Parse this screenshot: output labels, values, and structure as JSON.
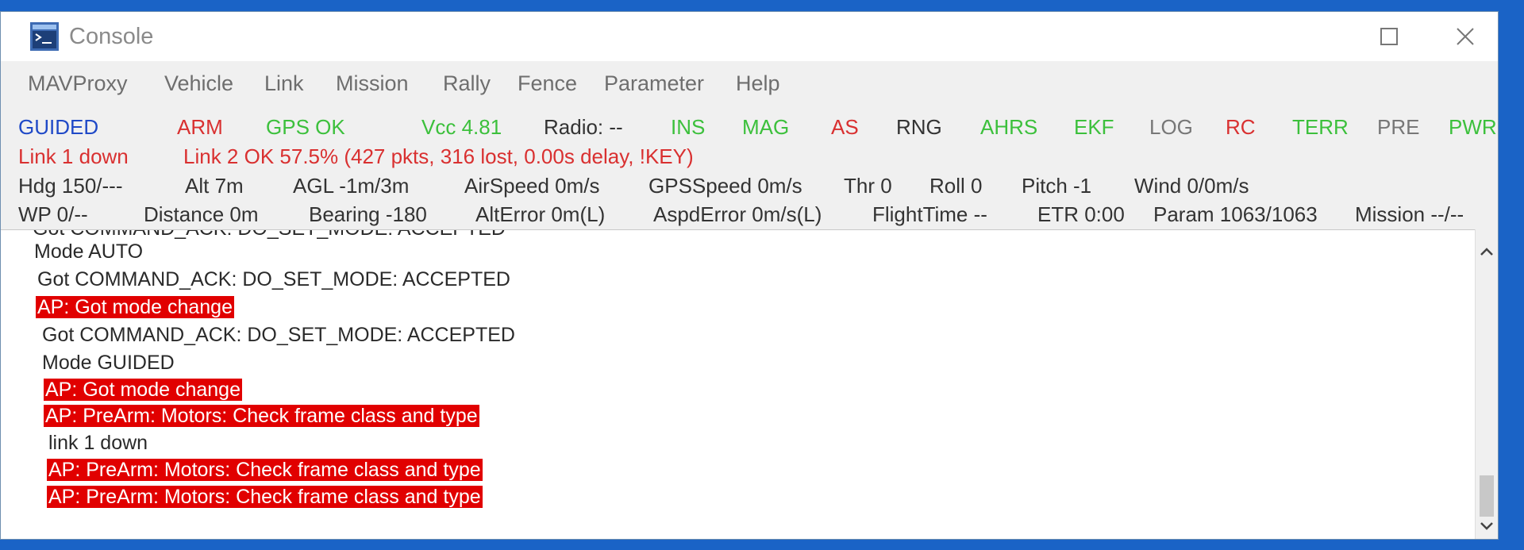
{
  "window": {
    "title": "Console",
    "icon": "terminal-app-icon"
  },
  "menu": [
    "MAVProxy",
    "Vehicle",
    "Link",
    "Mission",
    "Rally",
    "Fence",
    "Parameter",
    "Help"
  ],
  "status": {
    "row1": [
      {
        "text": "GUIDED",
        "color": "#1f49c7"
      },
      {
        "text": "ARM",
        "color": "#d93030"
      },
      {
        "text": "GPS OK",
        "color": "#3cc03c"
      },
      {
        "text": "Vcc 4.81",
        "color": "#3cc03c"
      },
      {
        "text": "Radio: --",
        "color": "#333333"
      },
      {
        "text": "INS",
        "color": "#3cc03c"
      },
      {
        "text": "MAG",
        "color": "#3cc03c"
      },
      {
        "text": "AS",
        "color": "#d93030"
      },
      {
        "text": "RNG",
        "color": "#333333"
      },
      {
        "text": "AHRS",
        "color": "#3cc03c"
      },
      {
        "text": "EKF",
        "color": "#3cc03c"
      },
      {
        "text": "LOG",
        "color": "#777777"
      },
      {
        "text": "RC",
        "color": "#d93030"
      },
      {
        "text": "TERR",
        "color": "#3cc03c"
      },
      {
        "text": "PRE",
        "color": "#777777"
      },
      {
        "text": "PWR",
        "color": "#3cc03c"
      }
    ],
    "row2": [
      {
        "text": "Link 1 down",
        "color": "#d93030"
      },
      {
        "text": "Link 2 OK 57.5% (427 pkts, 316 lost, 0.00s delay, !KEY)",
        "color": "#d93030"
      }
    ],
    "row3": [
      {
        "text": "Hdg 150/---",
        "color": "#333333"
      },
      {
        "text": "Alt 7m",
        "color": "#333333"
      },
      {
        "text": "AGL -1m/3m",
        "color": "#333333"
      },
      {
        "text": "AirSpeed 0m/s",
        "color": "#333333"
      },
      {
        "text": "GPSSpeed 0m/s",
        "color": "#333333"
      },
      {
        "text": "Thr 0",
        "color": "#333333"
      },
      {
        "text": "Roll 0",
        "color": "#333333"
      },
      {
        "text": "Pitch -1",
        "color": "#333333"
      },
      {
        "text": "Wind 0/0m/s",
        "color": "#333333"
      }
    ],
    "row4": [
      {
        "text": "WP 0/--",
        "color": "#333333"
      },
      {
        "text": "Distance 0m",
        "color": "#333333"
      },
      {
        "text": "Bearing -180",
        "color": "#333333"
      },
      {
        "text": "AltError 0m(L)",
        "color": "#333333"
      },
      {
        "text": "AspdError 0m/s(L)",
        "color": "#333333"
      },
      {
        "text": "FlightTime --",
        "color": "#333333"
      },
      {
        "text": "ETR 0:00",
        "color": "#333333"
      },
      {
        "text": "Param 1063/1063",
        "color": "#333333"
      },
      {
        "text": "Mission --/--",
        "color": "#333333"
      }
    ]
  },
  "console_lines": [
    {
      "text": "Got COMMAND_ACK: DO_SET_MODE: ACCEPTED",
      "highlight": false
    },
    {
      "text": "Mode AUTO",
      "highlight": false
    },
    {
      "text": "Got COMMAND_ACK: DO_SET_MODE: ACCEPTED",
      "highlight": false
    },
    {
      "text": "AP: Got mode change",
      "highlight": true
    },
    {
      "text": "Got COMMAND_ACK: DO_SET_MODE: ACCEPTED",
      "highlight": false
    },
    {
      "text": "Mode GUIDED",
      "highlight": false
    },
    {
      "text": "AP: Got mode change",
      "highlight": true
    },
    {
      "text": "AP: PreArm: Motors: Check frame class and type",
      "highlight": true
    },
    {
      "text": "link 1 down",
      "highlight": false
    },
    {
      "text": "AP: PreArm: Motors: Check frame class and type",
      "highlight": true
    },
    {
      "text": "AP: PreArm: Motors: Check frame class and type",
      "highlight": true
    }
  ],
  "scrollbar": {
    "up_icon": "chevron-up-icon",
    "down_icon": "chevron-down-icon",
    "position": 0.95
  }
}
